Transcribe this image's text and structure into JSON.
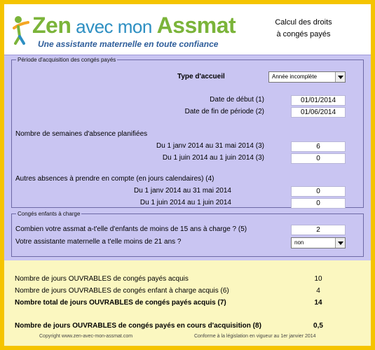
{
  "header": {
    "logo_zen": "Zen",
    "logo_mid": " avec mon ",
    "logo_assmat": "Assmat",
    "tagline": "Une assistante maternelle en toute confiance",
    "title_line1": "Calcul des droits",
    "title_line2": "à congés payés"
  },
  "colors": {
    "frame": "#f5c400",
    "main_bg": "#c9c5f2",
    "results_bg": "#fbf7c0",
    "logo_green": "#7bb43a",
    "logo_blue": "#2d8fc2"
  },
  "acquisition": {
    "legend": "Période d'acquisition  des congés payés",
    "type_label": "Type d'accueil",
    "type_value": "Année incomplète",
    "start_label": "Date de début (1)",
    "start_value": "01/01/2014",
    "end_label": "Date de fin de période (2)",
    "end_value": "01/06/2014",
    "weeks_title": "Nombre de semaines d'absence planifiées",
    "weeks_row1_label": "Du 1 janv 2014 au 31 mai 2014 (3)",
    "weeks_row1_value": "6",
    "weeks_row2_label": "Du 1 juin 2014 au 1 juin 2014 (3)",
    "weeks_row2_value": "0",
    "other_title": "Autres absences à prendre en compte (en jours calendaires) (4)",
    "other_row1_label": "Du 1 janv 2014 au 31 mai 2014",
    "other_row1_value": "0",
    "other_row2_label": "Du 1 juin 2014 au 1 juin 2014",
    "other_row2_value": "0"
  },
  "children": {
    "legend": "Congés enfants  à charge",
    "q1_label": "Combien votre assmat a-t'elle d'enfants de moins de 15 ans à charge ?  (5)",
    "q1_value": "2",
    "q2_label": "Votre assistante maternelle a t'elle moins de 21 ans ?",
    "q2_value": "non"
  },
  "results": {
    "r1_label": "Nombre de jours OUVRABLES de congés payés acquis",
    "r1_value": "10",
    "r2_label": "Nombre de jours OUVRABLES de congés enfant à charge acquis (6)",
    "r2_value": "4",
    "r3_label": "Nombre total de jours OUVRABLES de congés payés acquis (7)",
    "r3_value": "14",
    "r4_label": "Nombre de jours OUVRABLES de congés payés  en cours d'acquisition (8)",
    "r4_value": "0,5"
  },
  "footer": {
    "left": "Copyright www.zen-avec-mon-assmat.com",
    "right": "Conforme à la législation en vigueur au 1er janvier 2014"
  }
}
